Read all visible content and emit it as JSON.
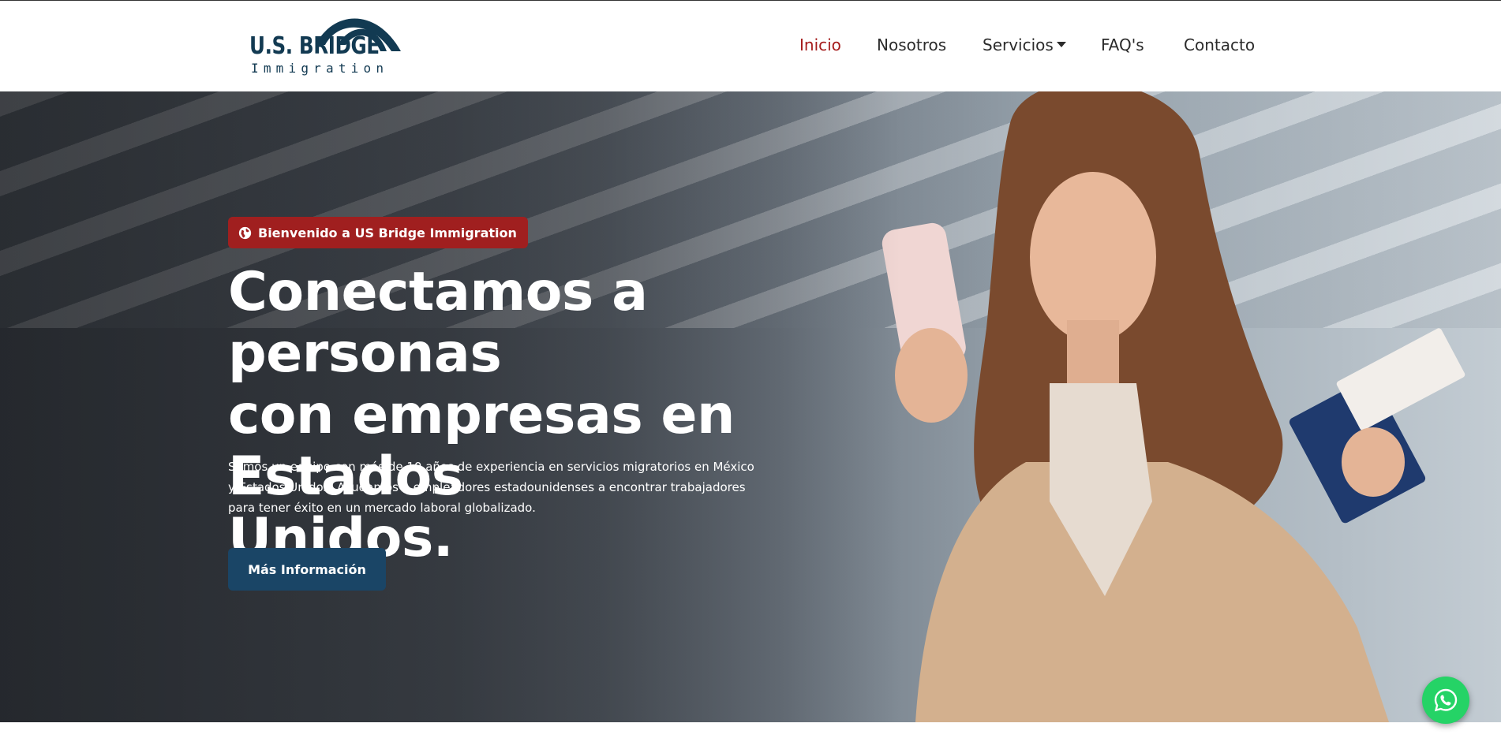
{
  "header": {
    "logo": {
      "title": "U.S. BRIDGE",
      "subtitle": "Immigration"
    },
    "nav": {
      "items": [
        {
          "label": "Inicio",
          "active": true
        },
        {
          "label": "Nosotros"
        },
        {
          "label": "Servicios",
          "has_dropdown": true
        },
        {
          "label": "FAQ's"
        },
        {
          "label": "Contacto"
        }
      ]
    }
  },
  "hero": {
    "badge": {
      "icon": "globe-icon",
      "label": "Bienvenido a US Bridge Immigration"
    },
    "title_lines": [
      "Conectamos a personas",
      "con empresas en Estados",
      "Unidos."
    ],
    "description_lines": [
      "Somos un equipo con más de 10 años de experiencia en servicios migratorios en México",
      "y Estados Unidos. Ayudamos a empleadores estadounidenses a encontrar trabajadores",
      "para tener éxito en un mercado laboral globalizado."
    ],
    "button_label": "Más Información"
  },
  "floating": {
    "whatsapp_icon": "whatsapp-icon"
  },
  "colors": {
    "brand_navy": "#123a52",
    "accent_red": "#a01f1f",
    "nav_active": "#a51c1c",
    "button_blue": "#1a4566",
    "whatsapp_green": "#25d366"
  }
}
